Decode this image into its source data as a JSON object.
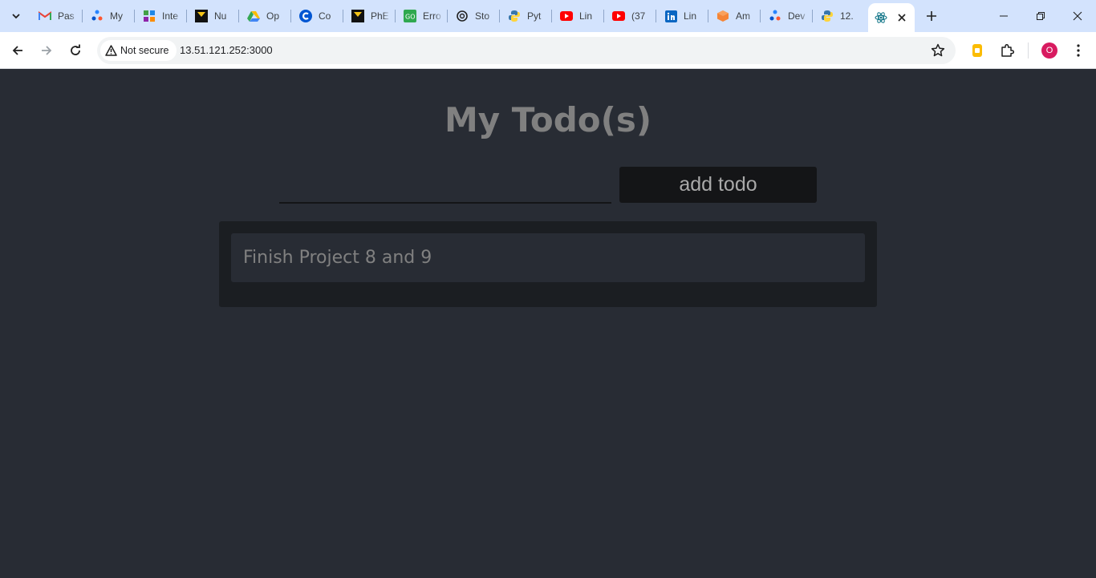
{
  "browser": {
    "tabs": [
      {
        "title": "Pas",
        "icon": "gmail-icon"
      },
      {
        "title": "My",
        "icon": "jira-icon"
      },
      {
        "title": "Inte",
        "icon": "grid-app-icon"
      },
      {
        "title": "Nu",
        "icon": "pnet-icon"
      },
      {
        "title": "Op",
        "icon": "google-drive-icon"
      },
      {
        "title": "Co",
        "icon": "coursera-icon"
      },
      {
        "title": "PhE",
        "icon": "pnet-icon"
      },
      {
        "title": "Erro",
        "icon": "go-icon"
      },
      {
        "title": "Sto",
        "icon": "openai-icon"
      },
      {
        "title": "Pyt",
        "icon": "python-icon"
      },
      {
        "title": "Lin",
        "icon": "youtube-icon"
      },
      {
        "title": "(37",
        "icon": "youtube-icon"
      },
      {
        "title": "Lin",
        "icon": "linkedin-icon"
      },
      {
        "title": "Am",
        "icon": "aws-icon"
      },
      {
        "title": "Dev",
        "icon": "jira-icon"
      },
      {
        "title": "12.",
        "icon": "python-icon"
      }
    ],
    "active_tab": {
      "icon": "react-icon"
    },
    "security_label": "Not secure",
    "url": "13.51.121.252:3000",
    "profile_initial": "O"
  },
  "page": {
    "title": "My Todo(s)",
    "input_value": "",
    "add_button_label": "add todo",
    "todos": [
      "Finish Project 8 and 9"
    ]
  }
}
